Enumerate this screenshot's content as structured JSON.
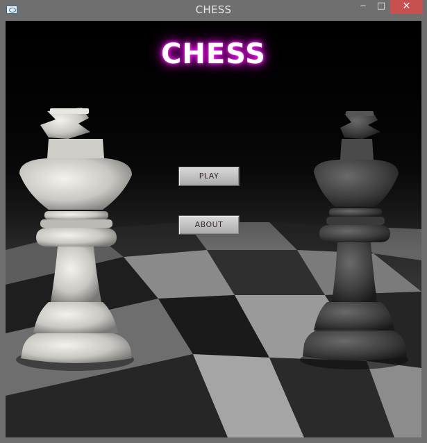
{
  "window": {
    "title": "CHESS",
    "controls": {
      "minimize": "‒",
      "maximize": "□",
      "close": "✕"
    }
  },
  "main": {
    "logo_text": "CHESS",
    "buttons": {
      "play": "PLAY",
      "about": "ABOUT"
    }
  },
  "colors": {
    "logo_glow": "#c81ec8",
    "close_button": "#c75050",
    "button_face": "#c4c4c4"
  },
  "icons": [
    "app-icon",
    "white-king-icon",
    "black-king-icon"
  ]
}
